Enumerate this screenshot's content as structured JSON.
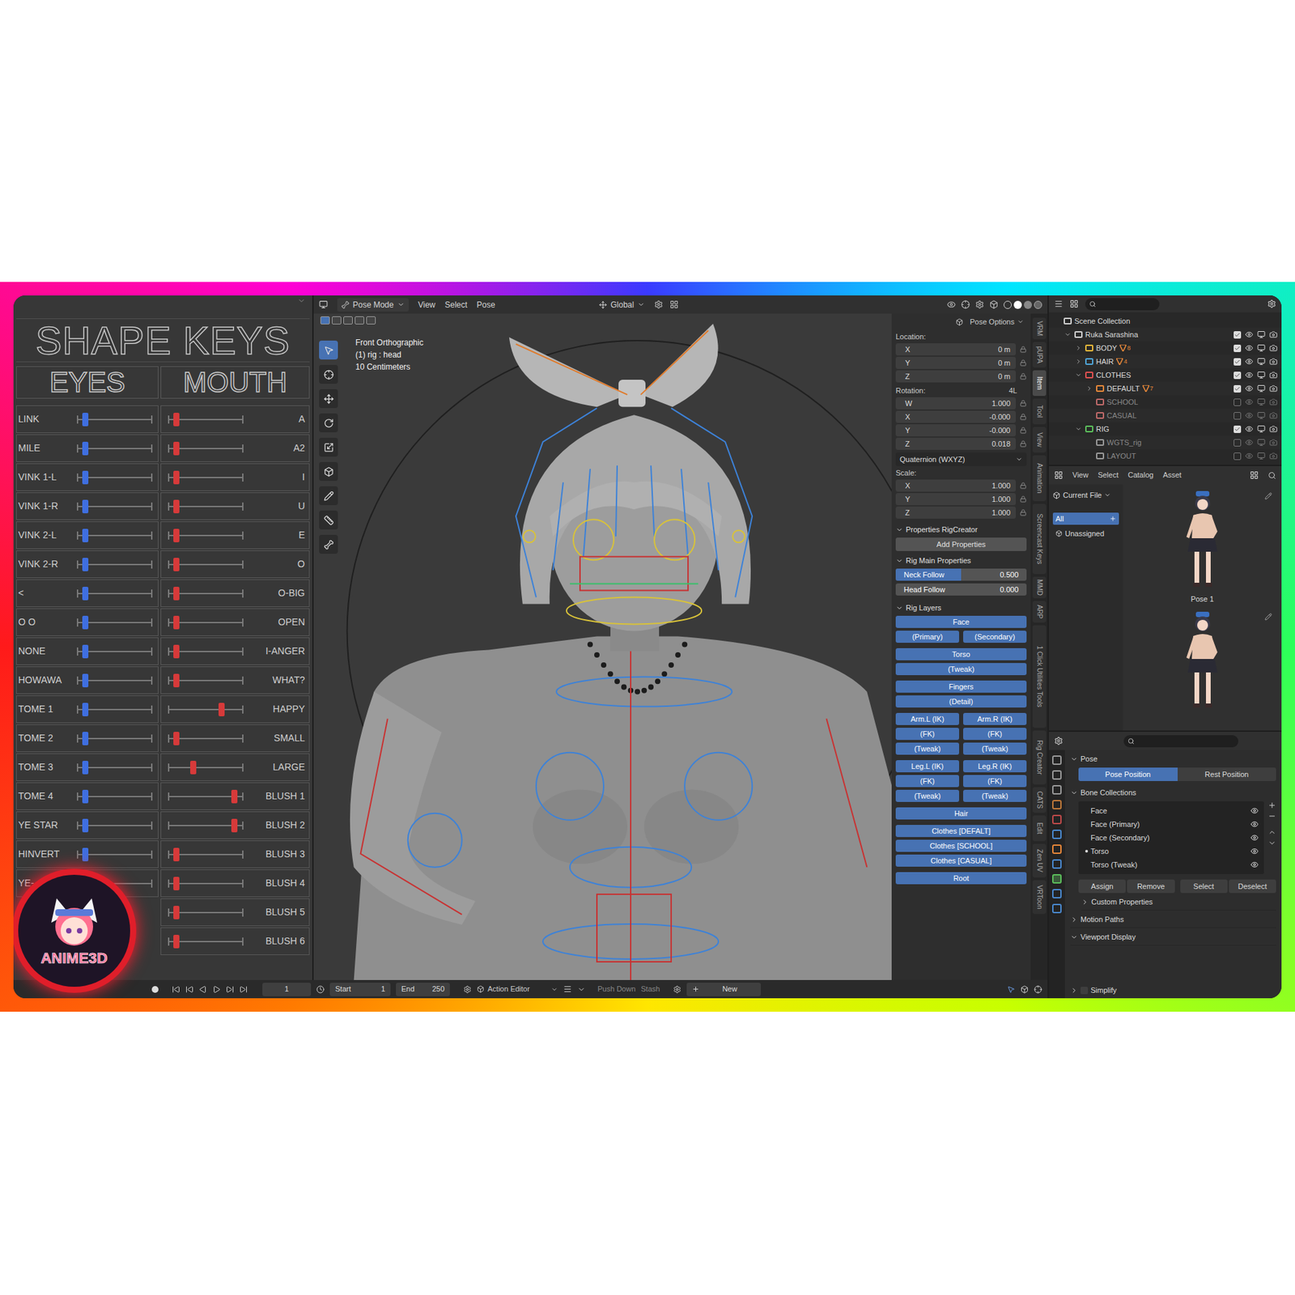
{
  "shape_keys": {
    "title": "SHAPE KEYS",
    "eyes_header": "EYES",
    "mouth_header": "MOUTH",
    "eyes": [
      {
        "label": "LINK",
        "level": 0.08
      },
      {
        "label": "MILE",
        "level": 0.08
      },
      {
        "label": "VINK 1-L",
        "level": 0.08
      },
      {
        "label": "VINK 1-R",
        "level": 0.08
      },
      {
        "label": "VINK 2-L",
        "level": 0.08
      },
      {
        "label": "VINK 2-R",
        "level": 0.08
      },
      {
        "label": "<",
        "level": 0.08
      },
      {
        "label": "O O",
        "level": 0.08
      },
      {
        "label": "NONE",
        "level": 0.08
      },
      {
        "label": "HOWAWA",
        "level": 0.08
      },
      {
        "label": "TOME 1",
        "level": 0.08
      },
      {
        "label": "TOME 2",
        "level": 0.08
      },
      {
        "label": "TOME 3",
        "level": 0.08
      },
      {
        "label": "TOME 4",
        "level": 0.08
      },
      {
        "label": "YE STAR",
        "level": 0.08
      },
      {
        "label": "HINVERT",
        "level": 0.08
      },
      {
        "label": "YE-",
        "level": 0.08
      }
    ],
    "mouth": [
      {
        "label": "A",
        "level": 0.08
      },
      {
        "label": "A2",
        "level": 0.08
      },
      {
        "label": "I",
        "level": 0.08
      },
      {
        "label": "U",
        "level": 0.08
      },
      {
        "label": "E",
        "level": 0.08
      },
      {
        "label": "O",
        "level": 0.08
      },
      {
        "label": "O-BIG",
        "level": 0.08
      },
      {
        "label": "OPEN",
        "level": 0.08
      },
      {
        "label": "I-ANGER",
        "level": 0.08
      },
      {
        "label": "WHAT?",
        "level": 0.08
      },
      {
        "label": "HAPPY",
        "level": 0.73
      },
      {
        "label": "SMALL",
        "level": 0.08
      },
      {
        "label": "LARGE",
        "level": 0.32
      },
      {
        "label": "BLUSH 1",
        "level": 0.91
      },
      {
        "label": "BLUSH 2",
        "level": 0.91
      },
      {
        "label": "BLUSH 3",
        "level": 0.08
      },
      {
        "label": "BLUSH 4",
        "level": 0.08
      },
      {
        "label": "BLUSH 5",
        "level": 0.08
      },
      {
        "label": "BLUSH 6",
        "level": 0.08
      }
    ]
  },
  "logo": {
    "text": "ANIME3D"
  },
  "viewport": {
    "mode": "Pose Mode",
    "menus": [
      "View",
      "Select",
      "Pose"
    ],
    "orientation": "Global",
    "pose_options": "Pose Options",
    "overlay": [
      "Front Orthographic",
      "(1) rig : head",
      "10 Centimeters"
    ]
  },
  "transform": {
    "location_label": "Location:",
    "location": [
      {
        "axis": "X",
        "value": "0 m"
      },
      {
        "axis": "Y",
        "value": "0 m"
      },
      {
        "axis": "Z",
        "value": "0 m"
      }
    ],
    "rotation_label": "Rotation:",
    "rotation_mode_short": "4L",
    "rotation": [
      {
        "axis": "W",
        "value": "1.000"
      },
      {
        "axis": "X",
        "value": "-0.000"
      },
      {
        "axis": "Y",
        "value": "-0.000"
      },
      {
        "axis": "Z",
        "value": "0.018"
      }
    ],
    "rotation_mode": "Quaternion (WXYZ)",
    "scale_label": "Scale:",
    "scale": [
      {
        "axis": "X",
        "value": "1.000"
      },
      {
        "axis": "Y",
        "value": "1.000"
      },
      {
        "axis": "Z",
        "value": "1.000"
      }
    ]
  },
  "rig_creator": {
    "title": "Properties RigCreator",
    "button": "Add Properties"
  },
  "rig_main": {
    "title": "Rig Main Properties",
    "sliders": [
      {
        "label": "Neck Follow",
        "value": "0.500",
        "level": 0.5
      },
      {
        "label": "Head Follow",
        "value": "0.000",
        "level": 0
      }
    ]
  },
  "rig_layers": {
    "title": "Rig Layers",
    "groups": [
      [
        [
          {
            "label": "Face",
            "selected": true
          }
        ],
        [
          {
            "label": "(Primary)",
            "selected": true
          },
          {
            "label": "(Secondary)",
            "selected": true
          }
        ]
      ],
      [
        [
          {
            "label": "Torso",
            "selected": true
          }
        ],
        [
          {
            "label": "(Tweak)",
            "selected": true
          }
        ]
      ],
      [
        [
          {
            "label": "Fingers",
            "selected": true
          }
        ],
        [
          {
            "label": "(Detail)",
            "selected": true
          }
        ]
      ],
      [
        [
          {
            "label": "Arm.L (IK)",
            "selected": true
          },
          {
            "label": "Arm.R (IK)",
            "selected": true
          }
        ],
        [
          {
            "label": "(FK)",
            "selected": true
          },
          {
            "label": "(FK)",
            "selected": true
          }
        ],
        [
          {
            "label": "(Tweak)",
            "selected": true
          },
          {
            "label": "(Tweak)",
            "selected": true
          }
        ]
      ],
      [
        [
          {
            "label": "Leg.L (IK)",
            "selected": true
          },
          {
            "label": "Leg.R (IK)",
            "selected": true
          }
        ],
        [
          {
            "label": "(FK)",
            "selected": true
          },
          {
            "label": "(FK)",
            "selected": true
          }
        ],
        [
          {
            "label": "(Tweak)",
            "selected": true
          },
          {
            "label": "(Tweak)",
            "selected": true
          }
        ]
      ],
      [
        [
          {
            "label": "Hair",
            "selected": true
          }
        ]
      ],
      [
        [
          {
            "label": "Clothes [DEFALT]",
            "selected": true
          }
        ],
        [
          {
            "label": "Clothes [SCHOOL]",
            "selected": true
          }
        ],
        [
          {
            "label": "Clothes [CASUAL]",
            "selected": true
          }
        ]
      ],
      [
        [
          {
            "label": "Root",
            "selected": true
          }
        ]
      ]
    ]
  },
  "sidebar_tabs": [
    {
      "label": "VRM",
      "selected": false
    },
    {
      "label": "pUPA",
      "selected": false
    },
    {
      "label": "Item",
      "selected": true
    },
    {
      "label": "Tool",
      "selected": false
    },
    {
      "label": "View",
      "selected": false
    },
    {
      "label": "Animation",
      "selected": false
    },
    {
      "label": "Screencast Keys",
      "selected": false
    },
    {
      "label": "MMD",
      "selected": false
    },
    {
      "label": "ARP",
      "selected": false
    },
    {
      "label": "1 Click Utilities Tools",
      "selected": false
    },
    {
      "label": "Rig Creator",
      "selected": false
    },
    {
      "label": "CATS",
      "selected": false
    },
    {
      "label": "Edit",
      "selected": false
    },
    {
      "label": "Zen UV",
      "selected": false
    },
    {
      "label": "VRToon",
      "selected": false
    }
  ],
  "outliner": {
    "items": [
      {
        "label": "Scene Collection",
        "depth": 0,
        "expandable": false,
        "expanded": false,
        "checked": true,
        "color": "#d0d0d0",
        "count": "",
        "toggles": false
      },
      {
        "label": "Ruka Sarashina",
        "depth": 1,
        "expandable": true,
        "expanded": true,
        "checked": true,
        "color": "#d0d0d0",
        "count": "",
        "toggles": true
      },
      {
        "label": "BODY",
        "depth": 2,
        "expandable": true,
        "expanded": false,
        "checked": true,
        "color": "#e8b83a",
        "count": "8",
        "toggles": true
      },
      {
        "label": "HAIR",
        "depth": 2,
        "expandable": true,
        "expanded": false,
        "checked": true,
        "color": "#4fa5d8",
        "count": "4",
        "toggles": true
      },
      {
        "label": "CLOTHES",
        "depth": 2,
        "expandable": true,
        "expanded": true,
        "checked": true,
        "color": "#e05252",
        "count": "",
        "toggles": true
      },
      {
        "label": "DEFAULT",
        "depth": 3,
        "expandable": true,
        "expanded": false,
        "checked": true,
        "color": "#e8883a",
        "count": "7",
        "toggles": true
      },
      {
        "label": "SCHOOL",
        "depth": 3,
        "expandable": false,
        "expanded": false,
        "checked": false,
        "color": "#c06a6a",
        "count": "",
        "toggles": true
      },
      {
        "label": "CASUAL",
        "depth": 3,
        "expandable": false,
        "expanded": false,
        "checked": false,
        "color": "#c06a6a",
        "count": "",
        "toggles": true
      },
      {
        "label": "RIG",
        "depth": 2,
        "expandable": true,
        "expanded": true,
        "checked": true,
        "color": "#5cc05c",
        "count": "",
        "toggles": true
      },
      {
        "label": "WGTS_rig",
        "depth": 3,
        "expandable": false,
        "expanded": false,
        "checked": false,
        "color": "#9a9a9a",
        "count": "",
        "toggles": true
      },
      {
        "label": "LAYOUT",
        "depth": 3,
        "expandable": false,
        "expanded": false,
        "checked": false,
        "color": "#9a9a9a",
        "count": "",
        "toggles": true
      }
    ]
  },
  "asset_browser": {
    "menus": [
      "View",
      "Select",
      "Catalog",
      "Asset"
    ],
    "library": "Current File",
    "catalogs": [
      {
        "label": "All",
        "selected": true
      },
      {
        "label": "Unassigned",
        "selected": false
      }
    ],
    "assets": [
      {
        "label": "Pose 1"
      },
      {
        "label": ""
      }
    ]
  },
  "properties": {
    "pose_title": "Pose",
    "position_toggle": [
      {
        "label": "Pose Position",
        "selected": true
      },
      {
        "label": "Rest Position",
        "selected": false
      }
    ],
    "bone_collections_title": "Bone Collections",
    "collections": [
      {
        "label": "Face",
        "active": false,
        "visible": true
      },
      {
        "label": "Face (Primary)",
        "active": false,
        "visible": true
      },
      {
        "label": "Face (Secondary)",
        "active": false,
        "visible": true
      },
      {
        "label": "Torso",
        "active": true,
        "visible": true
      },
      {
        "label": "Torso (Tweak)",
        "active": false,
        "visible": true
      }
    ],
    "actions": [
      "Assign",
      "Remove",
      "Select",
      "Deselect"
    ],
    "sections": [
      {
        "label": "Custom Properties",
        "expanded": false,
        "sub": true
      },
      {
        "label": "Motion Paths",
        "expanded": false,
        "sub": false
      },
      {
        "label": "Viewport Display",
        "expanded": true,
        "sub": false
      }
    ],
    "simplify": {
      "label": "Simplify",
      "checked": false
    }
  },
  "timeline": {
    "frame": "1",
    "start_label": "Start",
    "start": "1",
    "end_label": "End",
    "end": "250",
    "editor": "Action Editor",
    "push_down": "Push Down",
    "stash": "Stash",
    "new": "New"
  }
}
